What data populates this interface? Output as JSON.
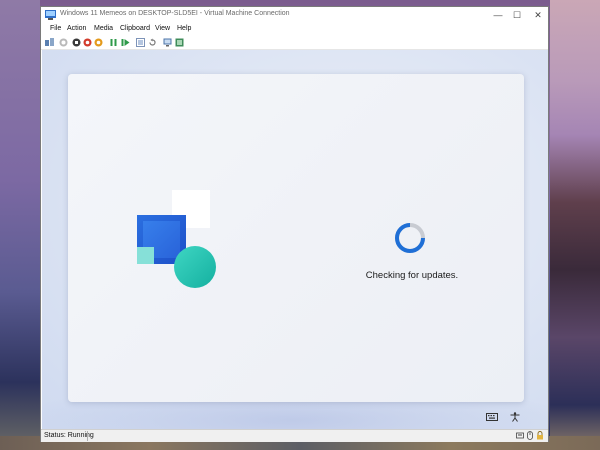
{
  "window": {
    "title": "Windows 11 Memeos on DESKTOP-SLD5EI - Virtual Machine Connection",
    "controls": {
      "minimize": "—",
      "maximize": "☐",
      "close": "✕"
    }
  },
  "menu": {
    "items": [
      {
        "label": "File"
      },
      {
        "label": "Action"
      },
      {
        "label": "Media"
      },
      {
        "label": "Clipboard"
      },
      {
        "label": "View"
      },
      {
        "label": "Help"
      }
    ]
  },
  "toolbar": {
    "icons": [
      "ctrl-alt-del-icon",
      "start-icon",
      "turn-off-icon",
      "shut-down-icon",
      "save-icon",
      "pause-icon",
      "resume-icon",
      "checkpoint-icon",
      "revert-icon",
      "enhanced-session-icon",
      "share-icon"
    ]
  },
  "vm": {
    "status_message": "Checking for updates."
  },
  "statusbar": {
    "status": "Status: Running"
  },
  "colors": {
    "accent_blue": "#1d4fc8",
    "teal": "#14b0a0",
    "spinner_track": "#c8cbd2",
    "spinner_arc": "#1f6fd6"
  }
}
